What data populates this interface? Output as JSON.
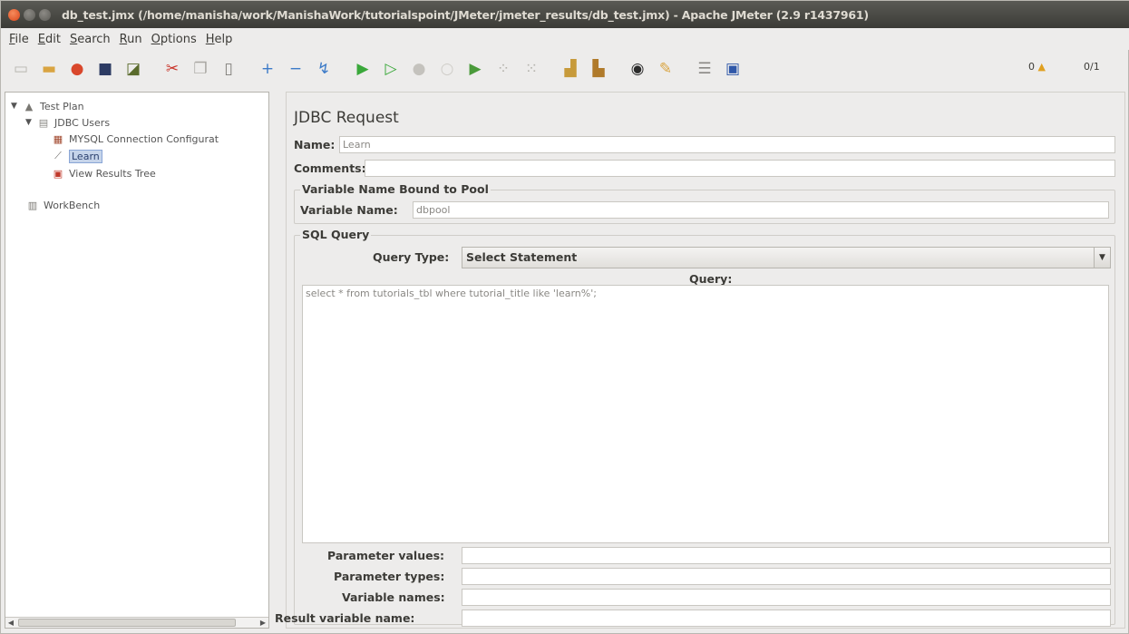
{
  "window": {
    "title": "db_test.jmx (/home/manisha/work/ManishaWork/tutorialspoint/JMeter/jmeter_results/db_test.jmx) - Apache JMeter (2.9 r1437961)"
  },
  "menu": [
    {
      "mnemonic": "F",
      "rest": "ile"
    },
    {
      "mnemonic": "E",
      "rest": "dit"
    },
    {
      "mnemonic": "S",
      "rest": "earch"
    },
    {
      "mnemonic": "R",
      "rest": "un"
    },
    {
      "mnemonic": "O",
      "rest": "ptions"
    },
    {
      "mnemonic": "H",
      "rest": "elp"
    }
  ],
  "toolbar": {
    "error_count": "0",
    "threads": "0/1"
  },
  "tree": {
    "items": [
      {
        "label": "Test Plan",
        "icon": "test-plan-icon"
      },
      {
        "label": "JDBC Users",
        "icon": "thread-group-icon"
      },
      {
        "label": "MYSQL Connection Configurat",
        "icon": "config-element-icon"
      },
      {
        "label": "Learn",
        "icon": "sampler-icon"
      },
      {
        "label": "View Results Tree",
        "icon": "listener-icon"
      },
      {
        "label": "WorkBench",
        "icon": "workbench-icon"
      }
    ]
  },
  "form": {
    "title": "JDBC Request",
    "name_label": "Name:",
    "name_value": "Learn",
    "comments_label": "Comments:",
    "comments_value": "",
    "pool_group_title": "Variable Name Bound to Pool",
    "variable_name_label": "Variable Name:",
    "variable_name_value": "dbpool",
    "sql_group_title": "SQL Query",
    "query_type_label": "Query Type:",
    "query_type_value": "Select Statement",
    "query_label": "Query:",
    "query_value": "select * from tutorials_tbl  where tutorial_title like 'learn%';",
    "parameter_values_label": "Parameter values:",
    "parameter_types_label": "Parameter types:",
    "variable_names_label": "Variable names:",
    "result_variable_name_label": "Result variable name:"
  }
}
